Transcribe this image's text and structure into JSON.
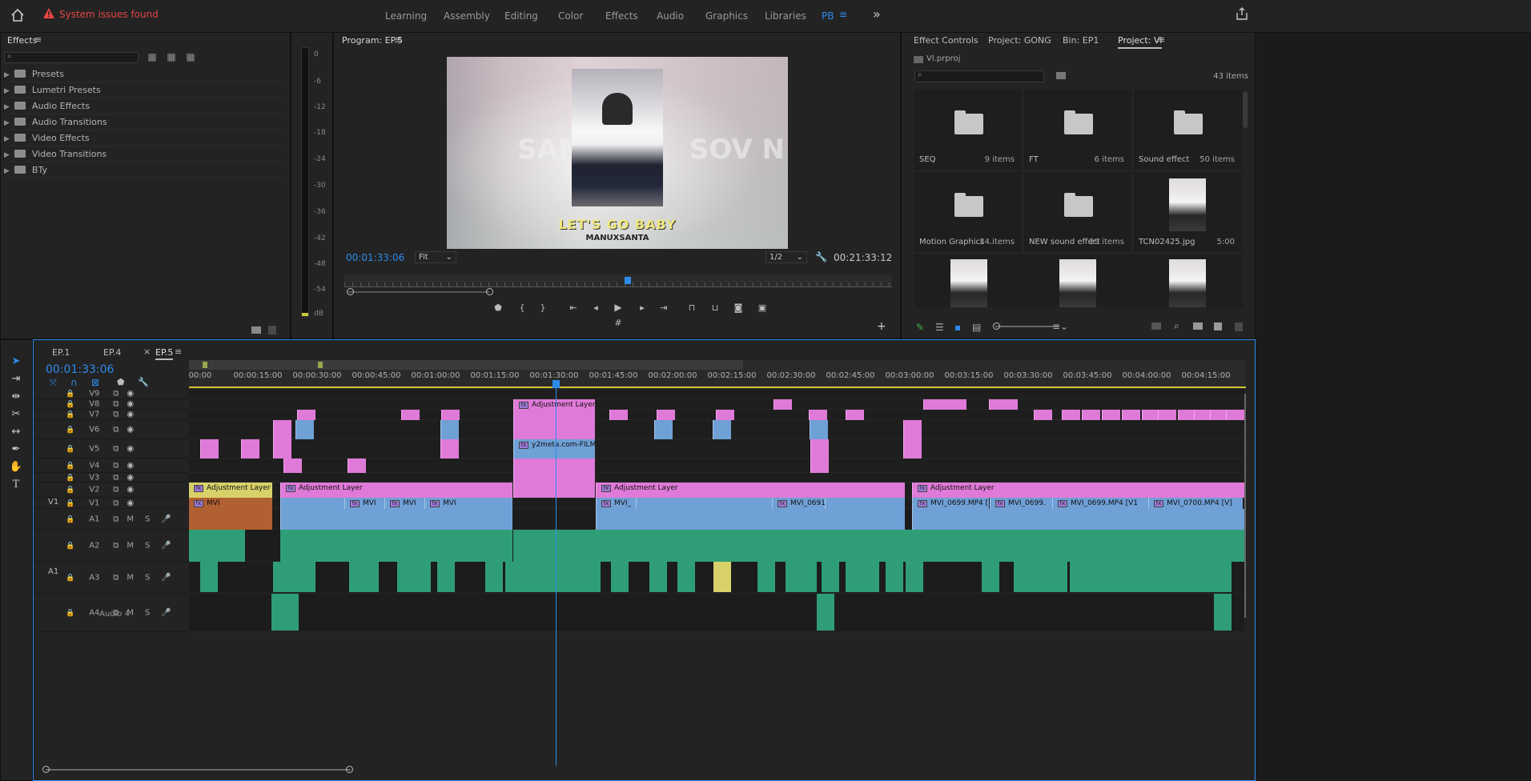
{
  "topbar": {
    "home_icon": "home-icon",
    "alert": "System issues found",
    "tabs": [
      "Learning",
      "Assembly",
      "Editing",
      "Color",
      "Effects",
      "Audio",
      "Graphics",
      "Libraries",
      "PB"
    ],
    "active_tab": "PB",
    "more": "»",
    "accent": "#2d8ceb",
    "alert_color": "#e74545"
  },
  "effects_panel": {
    "title": "Effects",
    "items": [
      "Presets",
      "Lumetri Presets",
      "Audio Effects",
      "Audio Transitions",
      "Video Effects",
      "Video Transitions",
      "BTy"
    ]
  },
  "vu_meter": {
    "scale": [
      "0",
      "-6",
      "-12",
      "-18",
      "-24",
      "-30",
      "-36",
      "-42",
      "-48",
      "-54",
      "dB"
    ]
  },
  "program_monitor": {
    "title": "Program: EP.5",
    "overlay_text": "SAM           SOV N",
    "caption_main": "LET'S GO BABY",
    "caption_sub": "MANUXSANTA",
    "timecode": "00:01:33:06",
    "fit": "Fit",
    "resolution": "1/2",
    "duration": "00:21:33:12"
  },
  "project_panel": {
    "tabs": [
      "Effect Controls",
      "Project: GONG",
      "Bin: EP1",
      "Project: Vl"
    ],
    "active_tab": "Project: Vl",
    "file": "Vl.prproj",
    "item_count": "43 items",
    "tiles": [
      {
        "name": "SEQ",
        "count": "9 items",
        "kind": "folder"
      },
      {
        "name": "FT",
        "count": "6 items",
        "kind": "folder"
      },
      {
        "name": "Sound effect",
        "count": "50 items",
        "kind": "folder"
      },
      {
        "name": "Motion Graphics ...",
        "count": "24 items",
        "kind": "folder"
      },
      {
        "name": "NEW sound effect",
        "count": "29 items",
        "kind": "folder"
      },
      {
        "name": "TCN02425.jpg",
        "count": "5:00",
        "kind": "image"
      }
    ]
  },
  "timeline": {
    "tabs": [
      "EP.1",
      "EP.4",
      "EP.5"
    ],
    "active_tab": "EP.5",
    "close_glyph": "×",
    "timecode": "00:01:33:06",
    "ruler": [
      "00:00",
      "00:00:15:00",
      "00:00:30:00",
      "00:00:45:00",
      "00:01:00:00",
      "00:01:15:00",
      "00:01:30:00",
      "00:01:45:00",
      "00:02:00:00",
      "00:02:15:00",
      "00:02:30:00",
      "00:02:45:00",
      "00:03:00:00",
      "00:03:15:00",
      "00:03:30:00",
      "00:03:45:00",
      "00:04:00:00",
      "00:04:15:00"
    ],
    "video_tracks": [
      "V9",
      "V8",
      "V7",
      "V6",
      "V5",
      "V4",
      "V3",
      "V2",
      "V1"
    ],
    "audio_tracks": [
      "A1",
      "A2",
      "A3",
      "A4"
    ],
    "source_v": "V1",
    "source_a": "A1",
    "audio4_name": "Audio 4",
    "track_buttons": {
      "mute": "M",
      "solo": "S"
    },
    "clips": {
      "adj1": "Adjustment Layer",
      "adj2": "Adjustment Layer",
      "adj3": "Adjustment Layer",
      "adj4": "Adjustment Layer",
      "adj5": "Adjustment Layer",
      "y2meta": "y2meta.com-FILM DA",
      "mvi_a": "MVI",
      "mvi_b": "MVI",
      "mvi_c": "MVI",
      "mvi_d": "MVI",
      "mvi_e": "MVI_",
      "mvi_f": "MVI_0691.",
      "mvi_g": "MVI_0699.MP4 [",
      "mvi_h": "MVI_0699.",
      "mvi_i": "MVI_0699.MP4 [V1",
      "mvi_j": "MVI_0700.MP4 [V]"
    }
  },
  "tools": [
    "selection-tool",
    "track-select-tool",
    "ripple-edit-tool",
    "razor-tool",
    "slip-tool",
    "pen-tool",
    "hand-tool",
    "type-tool"
  ],
  "type_tool_glyph": "T"
}
